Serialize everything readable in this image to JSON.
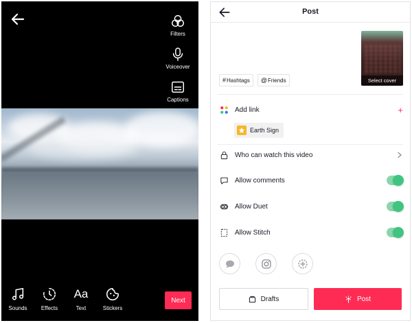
{
  "editor": {
    "tools": [
      {
        "label": "Filters",
        "icon": "filters-icon"
      },
      {
        "label": "Voiceover",
        "icon": "microphone-icon"
      },
      {
        "label": "Captions",
        "icon": "captions-icon"
      }
    ],
    "bottom_tools": [
      {
        "label": "Sounds",
        "icon": "music-note-icon"
      },
      {
        "label": "Effects",
        "icon": "effects-timer-icon"
      },
      {
        "label": "Text",
        "icon_text": "Aa"
      },
      {
        "label": "Stickers",
        "icon": "sticker-icon"
      }
    ],
    "next_label": "Next"
  },
  "post": {
    "title": "Post",
    "cover_label": "Select cover",
    "chips": {
      "hashtags": "Hashtags",
      "friends": "Friends",
      "hashtag_symbol": "#",
      "at_symbol": "@"
    },
    "add_link": {
      "label": "Add link",
      "trail": "+"
    },
    "earth_sign": "Earth Sign",
    "privacy": {
      "label": "Who can watch this video"
    },
    "toggles": [
      {
        "label": "Allow comments",
        "on": true
      },
      {
        "label": "Allow Duet",
        "on": true
      },
      {
        "label": "Allow Stitch",
        "on": true
      }
    ],
    "share_icons": [
      "message-bubble-icon",
      "instagram-icon",
      "add-circle-icon"
    ],
    "drafts_label": "Drafts",
    "post_label": "Post"
  },
  "colors": {
    "accent": "#fe2c55",
    "toggle": "#3fc57f",
    "earth_sign": "#f5b829"
  }
}
